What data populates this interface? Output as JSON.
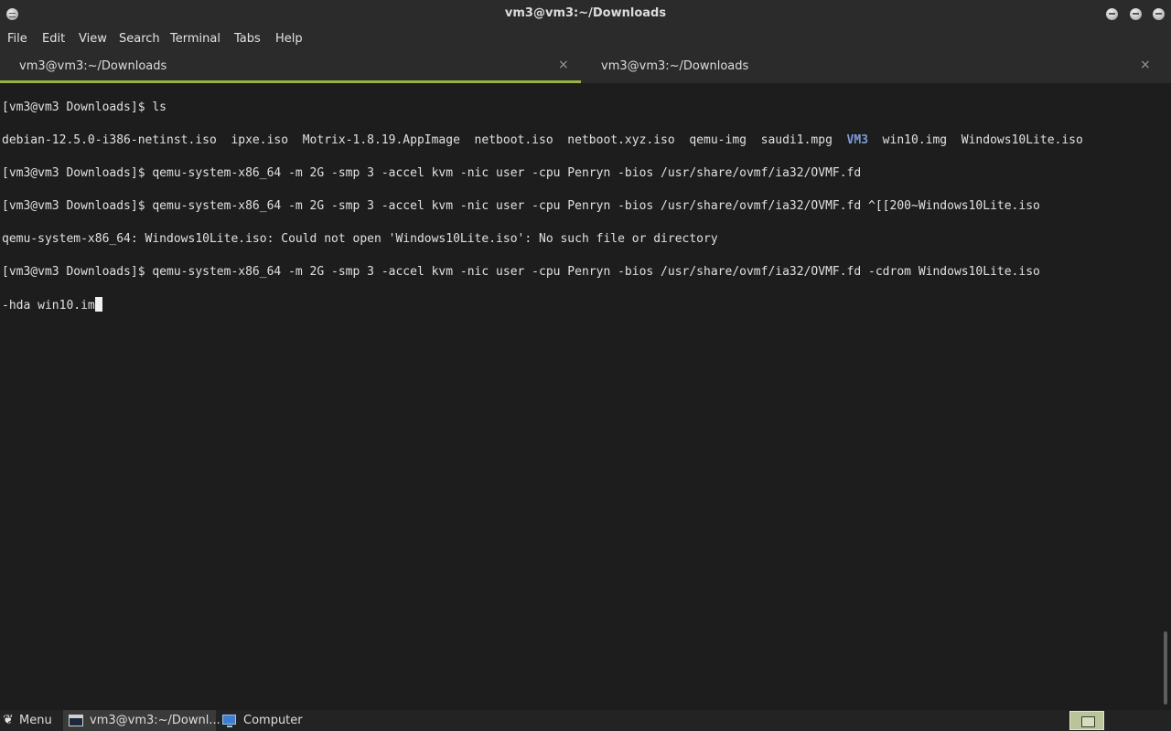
{
  "window": {
    "title": "vm3@vm3:~/Downloads"
  },
  "menubar": {
    "items": [
      "File",
      "Edit",
      "View",
      "Search",
      "Terminal",
      "Tabs",
      "Help"
    ]
  },
  "tabs": [
    {
      "label": "vm3@vm3:~/Downloads",
      "close": "×",
      "active": true
    },
    {
      "label": "vm3@vm3:~/Downloads",
      "close": "×",
      "active": false
    }
  ],
  "colors": {
    "active_tab_underline": "#97b443",
    "directory_listing": "#7f9bd6"
  },
  "terminal": {
    "line1": "[vm3@vm3 Downloads]$ ls",
    "ls_before_dir": "debian-12.5.0-i386-netinst.iso  ipxe.iso  Motrix-1.8.19.AppImage  netboot.iso  netboot.xyz.iso  qemu-img  saudi1.mpg  ",
    "ls_dir": "VM3",
    "ls_after_dir": "  win10.img  Windows10Lite.iso",
    "line3": "[vm3@vm3 Downloads]$ qemu-system-x86_64 -m 2G -smp 3 -accel kvm -nic user -cpu Penryn -bios /usr/share/ovmf/ia32/OVMF.fd",
    "line4": "[vm3@vm3 Downloads]$ qemu-system-x86_64 -m 2G -smp 3 -accel kvm -nic user -cpu Penryn -bios /usr/share/ovmf/ia32/OVMF.fd ^[[200~Windows10Lite.iso",
    "line5": "qemu-system-x86_64: Windows10Lite.iso: Could not open 'Windows10Lite.iso': No such file or directory",
    "line6": "[vm3@vm3 Downloads]$ qemu-system-x86_64 -m 2G -smp 3 -accel kvm -nic user -cpu Penryn -bios /usr/share/ovmf/ia32/OVMF.fd -cdrom Windows10Lite.iso",
    "line7": "-hda win10.im"
  },
  "taskbar": {
    "menu_label": "Menu",
    "menu_icon": "gnome-foot-icon",
    "window_label": "vm3@vm3:~/Downl...",
    "computer_label": "Computer",
    "show_desktop_icon": "show-desktop-icon"
  }
}
